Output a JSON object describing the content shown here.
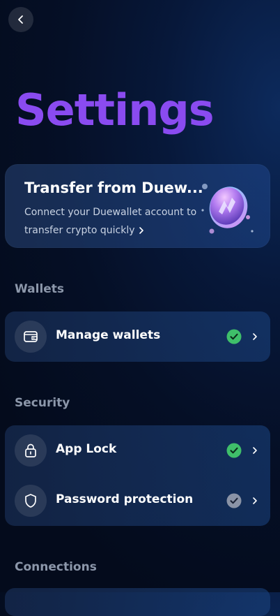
{
  "header": {
    "back_icon": "chevron-left-icon"
  },
  "page": {
    "title": "Settings"
  },
  "promo": {
    "title": "Transfer from Duew...",
    "description": "Connect your Duewallet account to transfer crypto quickly",
    "chevron_icon": "chevron-right-icon",
    "art_icon": "duewallet-coin-icon"
  },
  "sections": {
    "wallets": {
      "label": "Wallets",
      "items": [
        {
          "label": "Manage wallets",
          "icon": "wallet-icon",
          "status": "enabled",
          "status_icon": "check-circle-icon"
        }
      ]
    },
    "security": {
      "label": "Security",
      "items": [
        {
          "label": "App Lock",
          "icon": "lock-icon",
          "status": "enabled",
          "status_icon": "check-circle-icon"
        },
        {
          "label": "Password protection",
          "icon": "shield-icon",
          "status": "disabled",
          "status_icon": "check-circle-icon"
        }
      ]
    },
    "connections": {
      "label": "Connections"
    }
  },
  "colors": {
    "title_accent": "#8a4bf0",
    "status_enabled": "#3fbf6a",
    "status_disabled": "#8a93a6",
    "section_label": "#8c97aa"
  }
}
